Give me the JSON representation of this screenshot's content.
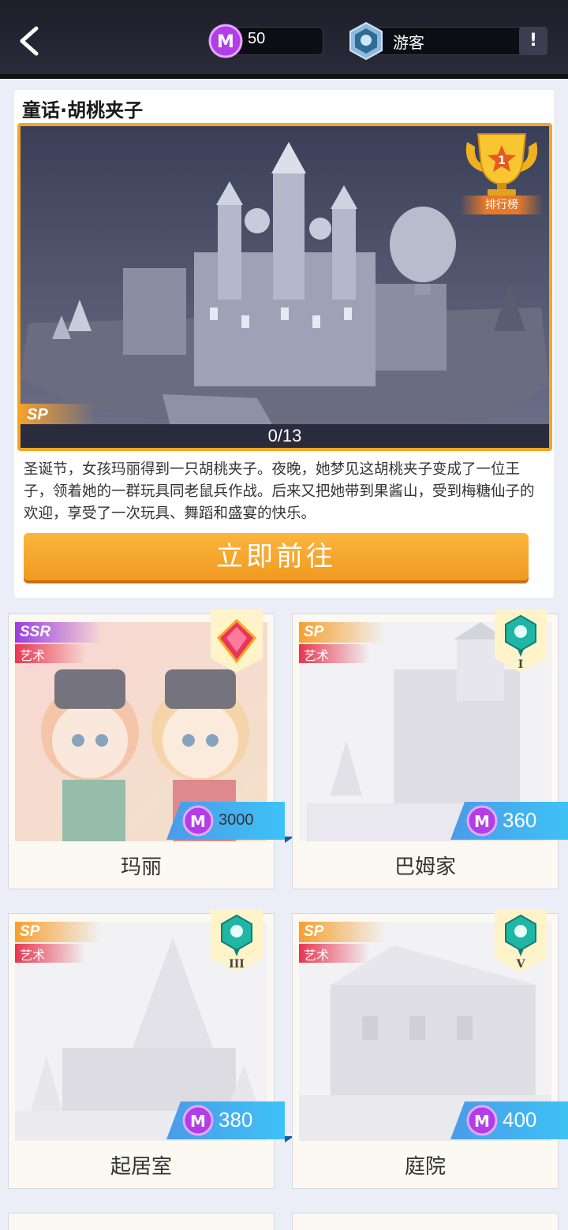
{
  "header": {
    "currency_value": "50",
    "user_name": "游客",
    "info_label": "!"
  },
  "story": {
    "title": "童话·胡桃夹子",
    "rank_label": "排行榜",
    "rank_number": "1",
    "badge": "SP",
    "progress_text": "0/13",
    "progress": 0,
    "description": "圣诞节，女孩玛丽得到一只胡桃夹子。夜晚，她梦见这胡桃夹子变成了一位王子，领着她的一群玩具同老鼠兵作战。后来又把她带到果酱山，受到梅糖仙子的欢迎，享受了一次玩具、舞蹈和盛宴的快乐。",
    "go_button": "立即前往"
  },
  "cards": [
    {
      "name": "玛丽",
      "rarity": "SSR",
      "category": "艺术",
      "price": "3000",
      "tier_icon": "diamond-crown-icon",
      "tier_label": ""
    },
    {
      "name": "巴姆家",
      "rarity": "SP",
      "category": "艺术",
      "price": "360",
      "tier_icon": "pin-gem-icon",
      "tier_label": "I"
    },
    {
      "name": "起居室",
      "rarity": "SP",
      "category": "艺术",
      "price": "380",
      "tier_icon": "pin-gem-icon",
      "tier_label": "III"
    },
    {
      "name": "庭院",
      "rarity": "SP",
      "category": "艺术",
      "price": "400",
      "tier_icon": "pin-gem-icon",
      "tier_label": "V"
    }
  ],
  "colors": {
    "accent_orange": "#f3a623",
    "ribbon_blue": "#3ec2f6",
    "category_red": "#e8364f",
    "ssr_purple": "#9b3de0"
  }
}
